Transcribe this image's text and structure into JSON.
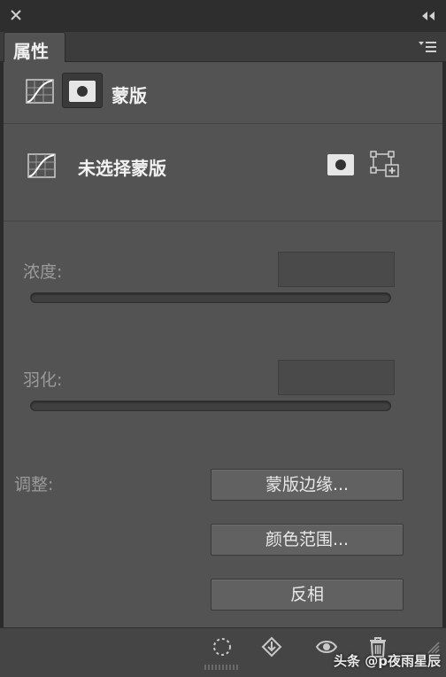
{
  "panel": {
    "tab_label": "属性",
    "mode_label": "蒙版",
    "status_label": "未选择蒙版"
  },
  "density": {
    "label": "浓度:",
    "value": ""
  },
  "feather": {
    "label": "羽化:",
    "value": ""
  },
  "refine": {
    "label": "调整:",
    "buttons": [
      "蒙版边缘...",
      "颜色范围...",
      "反相"
    ]
  },
  "watermark": "头条 @p夜雨星辰",
  "icons": {
    "close": "close-icon",
    "collapse": "collapse-icon",
    "panel_menu": "panel-menu-icon",
    "curves": "curves-icon",
    "pixel_mask": "pixel-mask-icon",
    "vector_mask": "vector-mask-add-icon",
    "selection": "load-selection-icon",
    "apply": "apply-mask-icon",
    "visibility": "eye-icon",
    "delete": "trash-icon"
  }
}
